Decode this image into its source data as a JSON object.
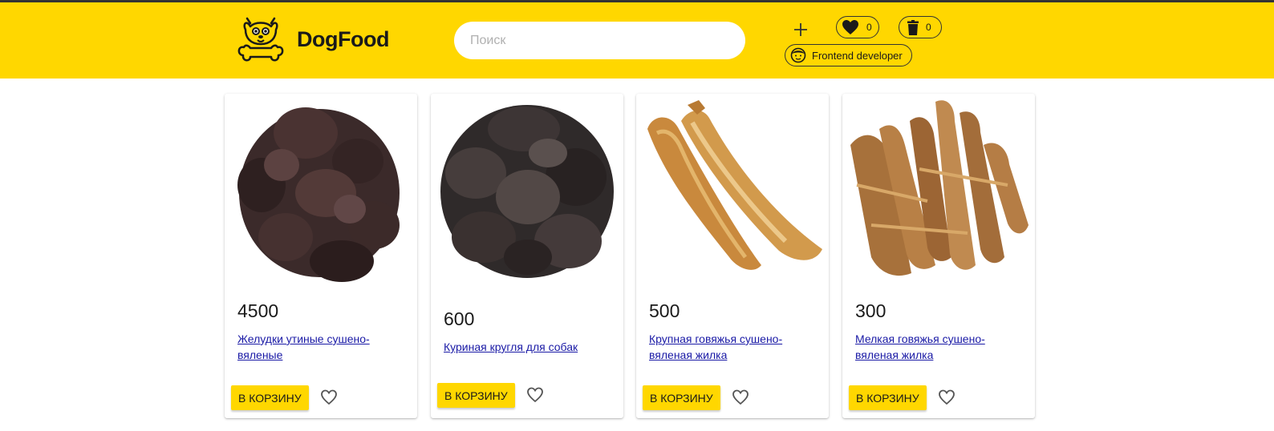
{
  "header": {
    "logo_text": "DogFood",
    "search_placeholder": "Поиск",
    "favorites_count": "0",
    "cart_count": "0",
    "user_label": "Frontend developer",
    "brand_color": "#FFD700"
  },
  "products": [
    {
      "price": "4500",
      "name": "Желудки утиные сушено-вяленые",
      "button": "В КОРЗИНУ"
    },
    {
      "price": "600",
      "name": "Куриная кругля для собак",
      "button": "В КОРЗИНУ"
    },
    {
      "price": "500",
      "name": "Крупная говяжья сушено-вяленая жилка",
      "button": "В КОРЗИНУ"
    },
    {
      "price": "300",
      "name": "Мелкая говяжья сушено-вяленая жилка",
      "button": "В КОРЗИНУ"
    }
  ],
  "icons": {
    "logo": "dog-bone-icon",
    "add": "plus-icon",
    "favorites": "heart-icon",
    "cart": "trash-icon",
    "user": "smiley-face-icon",
    "like": "heart-outline-icon"
  }
}
